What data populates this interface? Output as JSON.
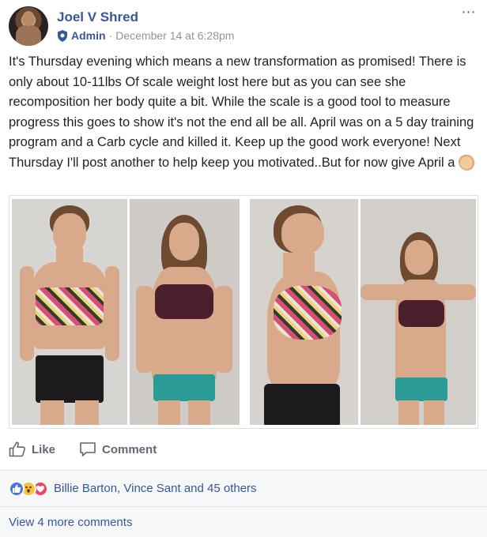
{
  "post": {
    "author": "Joel V Shred",
    "role": "Admin",
    "separator": "·",
    "timestamp": "December 14 at 6:28pm",
    "more_icon": "⋯",
    "message": "It's Thursday evening which means a new transformation as promised! There is only about 10-11lbs Of scale weight lost here but as you can see she recomposition her body quite a bit. While the scale is a good tool to measure progress this goes to show it's not the end all be all. April was on a 5 day training program and a Carb cycle and killed it. Keep up the good work everyone! Next Thursday I'll post another to help keep you motivated..But for now give April a",
    "message_emoji": "clapping-hands-icon"
  },
  "actions": {
    "like_label": "Like",
    "comment_label": "Comment"
  },
  "reactions": {
    "types": [
      "like",
      "wow",
      "love"
    ],
    "summary": "Billie Barton, Vince Sant and 45 others"
  },
  "comments": {
    "view_more": "View 4 more comments"
  },
  "colors": {
    "link": "#365899",
    "meta": "#90949c",
    "action": "#606770",
    "panel_bg": "#f6f7f9",
    "like": "#4a76d6",
    "wow": "#f5c33b",
    "love": "#f0465f"
  }
}
